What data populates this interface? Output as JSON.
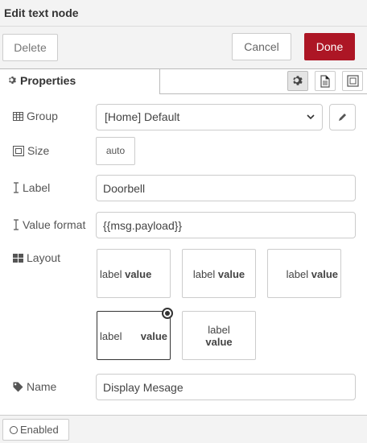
{
  "dialog": {
    "title": "Edit text node"
  },
  "buttons": {
    "delete": "Delete",
    "cancel": "Cancel",
    "done": "Done"
  },
  "tabs": {
    "properties": "Properties"
  },
  "form": {
    "group": {
      "label": "Group",
      "value": "[Home] Default"
    },
    "size": {
      "label": "Size",
      "value": "auto"
    },
    "label": {
      "label": "Label",
      "value": "Doorbell"
    },
    "value_format": {
      "label": "Value format",
      "value": "{{msg.payload}}"
    },
    "layout": {
      "label": "Layout",
      "options": [
        {
          "label": "label",
          "value": "value"
        },
        {
          "label": "label",
          "value": "value"
        },
        {
          "label": "label",
          "value": "value"
        },
        {
          "label": "label",
          "value": "value"
        },
        {
          "label": "label",
          "value": "value"
        }
      ],
      "selected_index": 3
    },
    "name": {
      "label": "Name",
      "value": "Display Mesage"
    }
  },
  "footer": {
    "enabled": "Enabled"
  },
  "colors": {
    "done": "#ad1625"
  }
}
